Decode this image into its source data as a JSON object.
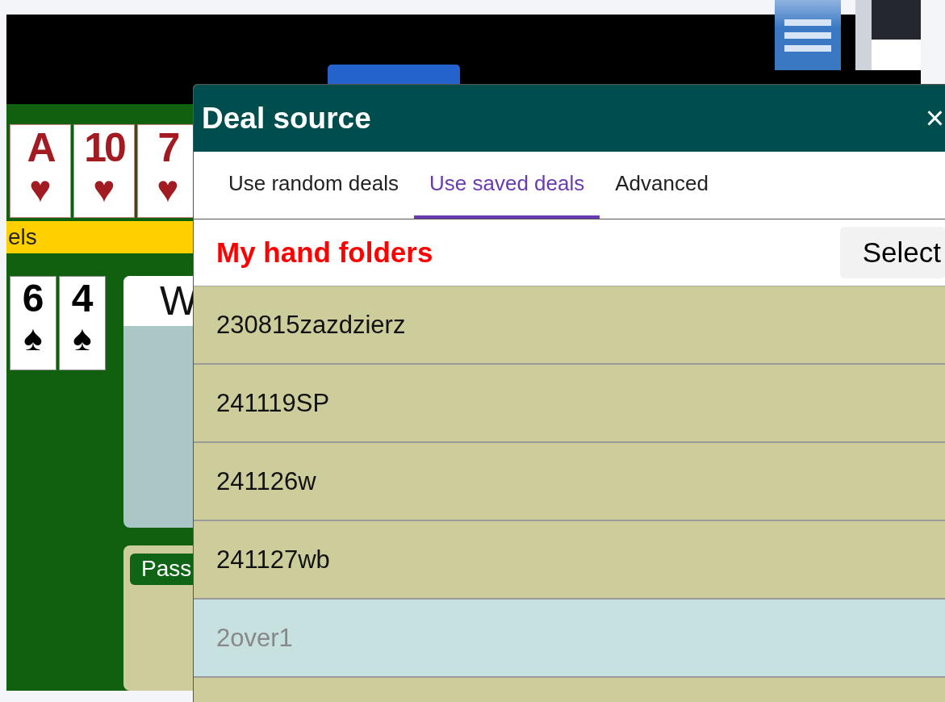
{
  "table": {
    "north_cards": [
      {
        "rank": "A",
        "suit": "♥",
        "color": "#a31b22"
      },
      {
        "rank": "10",
        "suit": "♥",
        "color": "#a31b22"
      },
      {
        "rank": "7",
        "suit": "♥",
        "color": "#a31b22"
      }
    ],
    "banner": "els",
    "west_cards": [
      {
        "rank": "6",
        "suit": "♠",
        "color": "#000000"
      },
      {
        "rank": "4",
        "suit": "♠",
        "color": "#000000"
      }
    ],
    "seat_label": "W",
    "bid_button": "Pass"
  },
  "dialog": {
    "title": "Deal source",
    "close": "×",
    "tabs": [
      {
        "label": "Use random deals",
        "selected": false
      },
      {
        "label": "Use saved deals",
        "selected": true
      },
      {
        "label": "Advanced",
        "selected": false
      }
    ],
    "section_title": "My hand folders",
    "select_button": "Select",
    "folders": [
      {
        "name": "230815zazdzierz",
        "selected": false
      },
      {
        "name": "241119SP",
        "selected": false
      },
      {
        "name": "241126w",
        "selected": false
      },
      {
        "name": "241127wb",
        "selected": false
      },
      {
        "name": "2over1",
        "selected": true
      }
    ]
  }
}
